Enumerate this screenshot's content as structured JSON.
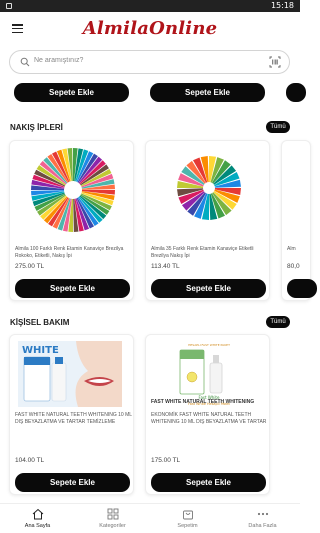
{
  "status_bar": {
    "time": "15:18"
  },
  "header": {
    "logo_text": "AlmilaOnline",
    "menu_icon": "hamburger-menu-icon"
  },
  "search": {
    "placeholder": "Ne aramıştınız?",
    "icon": "search-icon",
    "scan_icon": "barcode-scan-icon"
  },
  "top_row": {
    "buttons": [
      "Sepete Ekle",
      "Sepete Ekle",
      ""
    ]
  },
  "sections": [
    {
      "title": "NAKIŞ İPLERİ",
      "see_all": "Tümü",
      "products": [
        {
          "name": "Almila 100 Farklı Renk Etamin Kanaviçe Brezilya Rokoko, Etiketli, Nakış İpi",
          "price": "275.00 TL",
          "button": "Sepete Ekle"
        },
        {
          "name": "Almila 35 Farklı Renk Etamin Kanaviçe Etiketli Brezilya Nakış İpi",
          "price": "113.40 TL",
          "button": "Sepete Ekle"
        },
        {
          "name": "Alm",
          "price": "80,0",
          "button": ""
        }
      ]
    },
    {
      "title": "KİŞİSEL BAKIM",
      "see_all": "Tümü",
      "products": [
        {
          "name": "FAST WHITE NATURAL TEETH WHITENING 10 ML DIŞ BEYAZLATMA VE TARTAR TEMİZLEME",
          "price": "104.00 TL",
          "button": "Sepete Ekle",
          "image_text": "WHITE"
        },
        {
          "name": "FAST WHITE NATURAL TEETH WHITENING",
          "name2": "EKONOMİK FAST WHITE NATURAL TEETH WHITENING 10 ML DIŞ BEYAZLATMA VE TARTAR",
          "price": "175.00 TL",
          "button": "Sepete Ekle",
          "image_text": "Fast White",
          "image_caption": "Fast White Hesaplı Paket",
          "image_top": "HESAPLI FAST WHITE PAKET"
        }
      ]
    }
  ],
  "bottom_nav": [
    {
      "label": "Ana Sayfa",
      "icon": "home-icon",
      "active": true
    },
    {
      "label": "Kategoriler",
      "icon": "grid-icon",
      "active": false
    },
    {
      "label": "Sepetim",
      "icon": "cart-icon",
      "active": false
    },
    {
      "label": "Daha Fazla",
      "icon": "more-dots-icon",
      "active": false
    }
  ],
  "colors": {
    "logo": "#b0141a",
    "button": "#0a0a0a",
    "accent": "#ffffff"
  }
}
